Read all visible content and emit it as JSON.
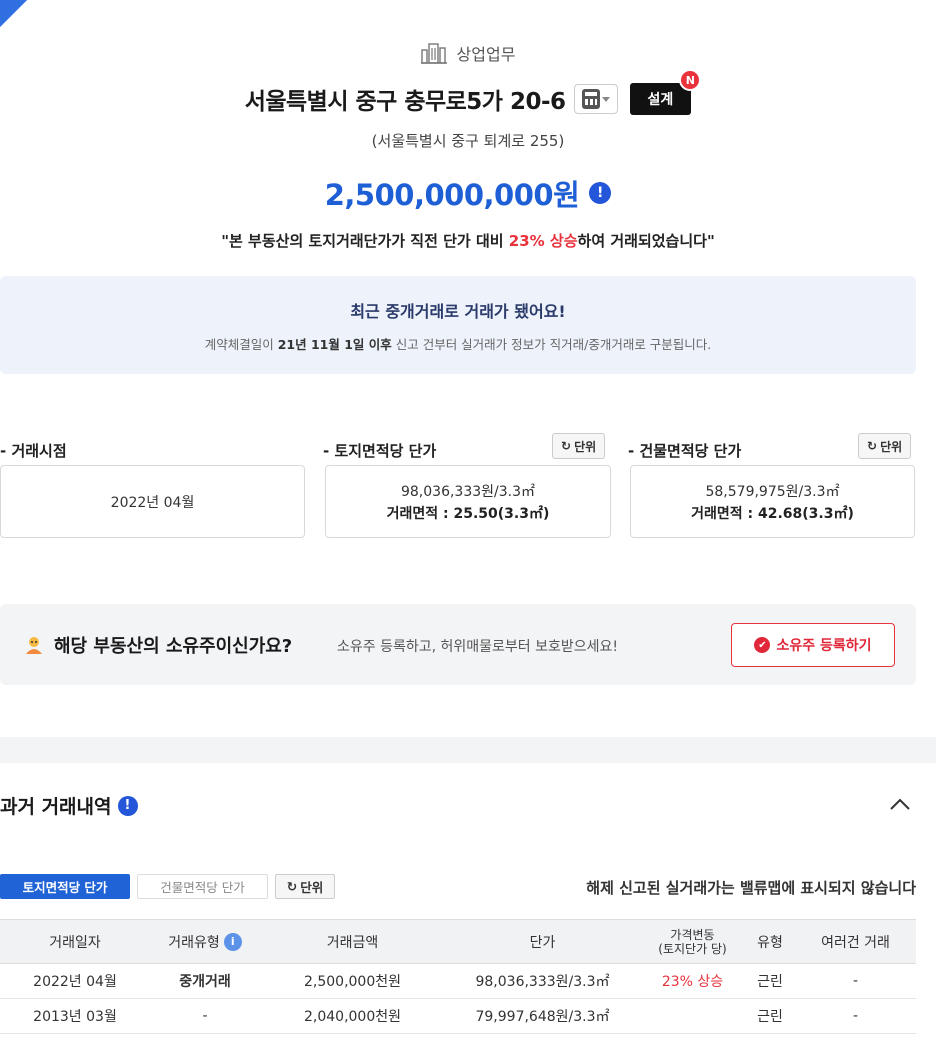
{
  "header": {
    "category": "상업업무",
    "address": "서울특별시 중구 충무로5가 20-6",
    "design_label": "설계",
    "new_badge": "N",
    "road_address": "(서울특별시 중구 퇴계로 255)",
    "price": "2,500,000,000원",
    "price_info_icon": "!",
    "quote_prefix": "\"본 부동산의 토지거래단가가 직전 단가 대비 ",
    "quote_highlight": "23% 상승",
    "quote_suffix": "하여 거래되었습니다\""
  },
  "notice": {
    "title": "최근 중개거래로 거래가 됐어요!",
    "sub_prefix": "계약체결일이 ",
    "sub_bold": "21년 11월 1일 이후",
    "sub_suffix": " 신고 건부터 실거래가 정보가 직거래/중개거래로 구분됩니다."
  },
  "stats": {
    "unit_label": "단위",
    "deal_time": {
      "label": "- 거래시점",
      "value": "2022년 04월"
    },
    "land_unit": {
      "label": "- 토지면적당 단가",
      "value": "98,036,333원/3.3㎡",
      "area": "거래면적 : 25.50(3.3㎡)"
    },
    "building_unit": {
      "label": "- 건물면적당 단가",
      "value": "58,579,975원/3.3㎡",
      "area": "거래면적 : 42.68(3.3㎡)"
    }
  },
  "owner": {
    "question": "해당 부동산의 소유주이신가요?",
    "desc": "소유주 등록하고, 허위매물로부터 보호받으세요!",
    "button": "소유주 등록하기"
  },
  "history": {
    "title": "과거 거래내역",
    "tabs": {
      "land": "토지면적당 단가",
      "building": "건물면적당 단가",
      "unit": "단위"
    },
    "note": "해제 신고된 실거래가는 밸류맵에 표시되지 않습니다",
    "columns": [
      "거래일자",
      "거래유형",
      "거래금액",
      "단가",
      "가격변동",
      "(토지단가 당)",
      "유형",
      "여러건 거래"
    ],
    "rows": [
      {
        "date": "2022년 04월",
        "type": "중개거래",
        "amount": "2,500,000천원",
        "unit_price": "98,036,333원/3.3㎡",
        "change": "23% 상승",
        "kind": "근린",
        "multi": "-"
      },
      {
        "date": "2013년 03월",
        "type": "-",
        "amount": "2,040,000천원",
        "unit_price": "79,997,648원/3.3㎡",
        "change": "",
        "kind": "근린",
        "multi": "-"
      }
    ]
  },
  "colors": {
    "accent_blue": "#1f63d6",
    "alert_red": "#e8323c",
    "notice_bg": "#eef2fb"
  }
}
